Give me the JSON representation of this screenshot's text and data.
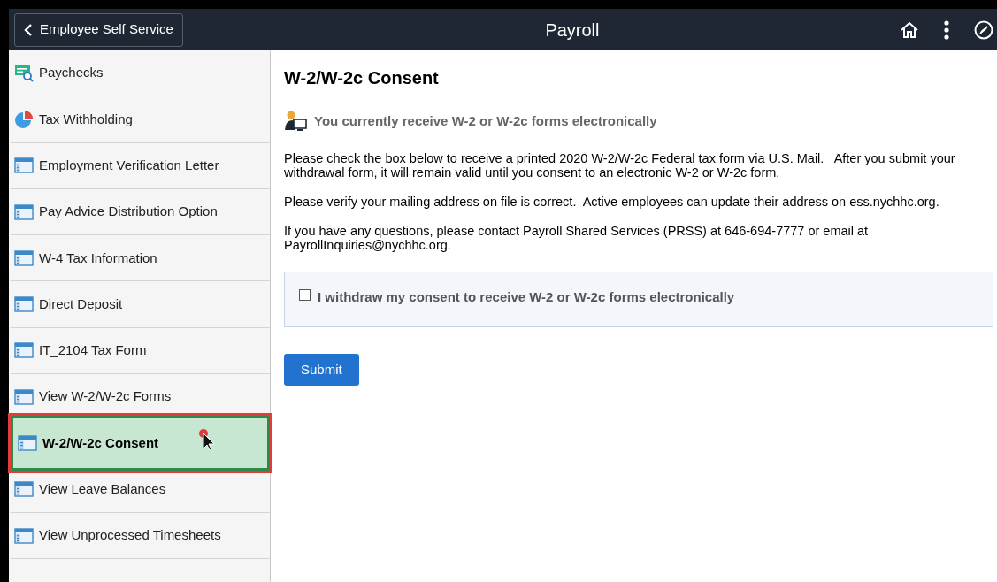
{
  "header": {
    "back_button": "Employee Self Service",
    "title": "Payroll"
  },
  "sidebar": {
    "items": [
      {
        "label": "Paychecks",
        "kind": "paychecks",
        "selected": false
      },
      {
        "label": "Tax Withholding",
        "kind": "pie",
        "selected": false
      },
      {
        "label": "Employment Verification Letter",
        "kind": "page",
        "selected": false
      },
      {
        "label": "Pay Advice Distribution Option",
        "kind": "page",
        "selected": false
      },
      {
        "label": "W-4 Tax Information",
        "kind": "page",
        "selected": false
      },
      {
        "label": "Direct Deposit",
        "kind": "page",
        "selected": false
      },
      {
        "label": "IT_2104 Tax Form",
        "kind": "page",
        "selected": false
      },
      {
        "label": "View W-2/W-2c Forms",
        "kind": "page",
        "selected": false
      },
      {
        "label": "W-2/W-2c Consent",
        "kind": "page",
        "selected": true
      },
      {
        "label": "View Leave Balances",
        "kind": "page",
        "selected": false
      },
      {
        "label": "View Unprocessed Timesheets",
        "kind": "page",
        "selected": false
      }
    ]
  },
  "content": {
    "title": "W-2/W-2c Consent",
    "status": "You currently receive W-2 or W-2c forms electronically",
    "paragraphs": [
      "Please check the box below to receive a printed 2020 W-2/W-2c Federal tax form via U.S. Mail.   After you submit your withdrawal form, it will remain valid until you consent to an electronic W-2 or W-2c form.",
      "Please verify your mailing address on file is correct.  Active employees can update their address on ess.nychhc.org.",
      "If you have any questions, please contact Payroll Shared Services (PRSS) at 646-694-7777 or email at PayrollInquiries@nychhc.org."
    ],
    "checkbox": {
      "label": "I withdraw my consent to receive W-2 or W-2c forms electronically",
      "checked": false
    },
    "submit_button": "Submit"
  }
}
